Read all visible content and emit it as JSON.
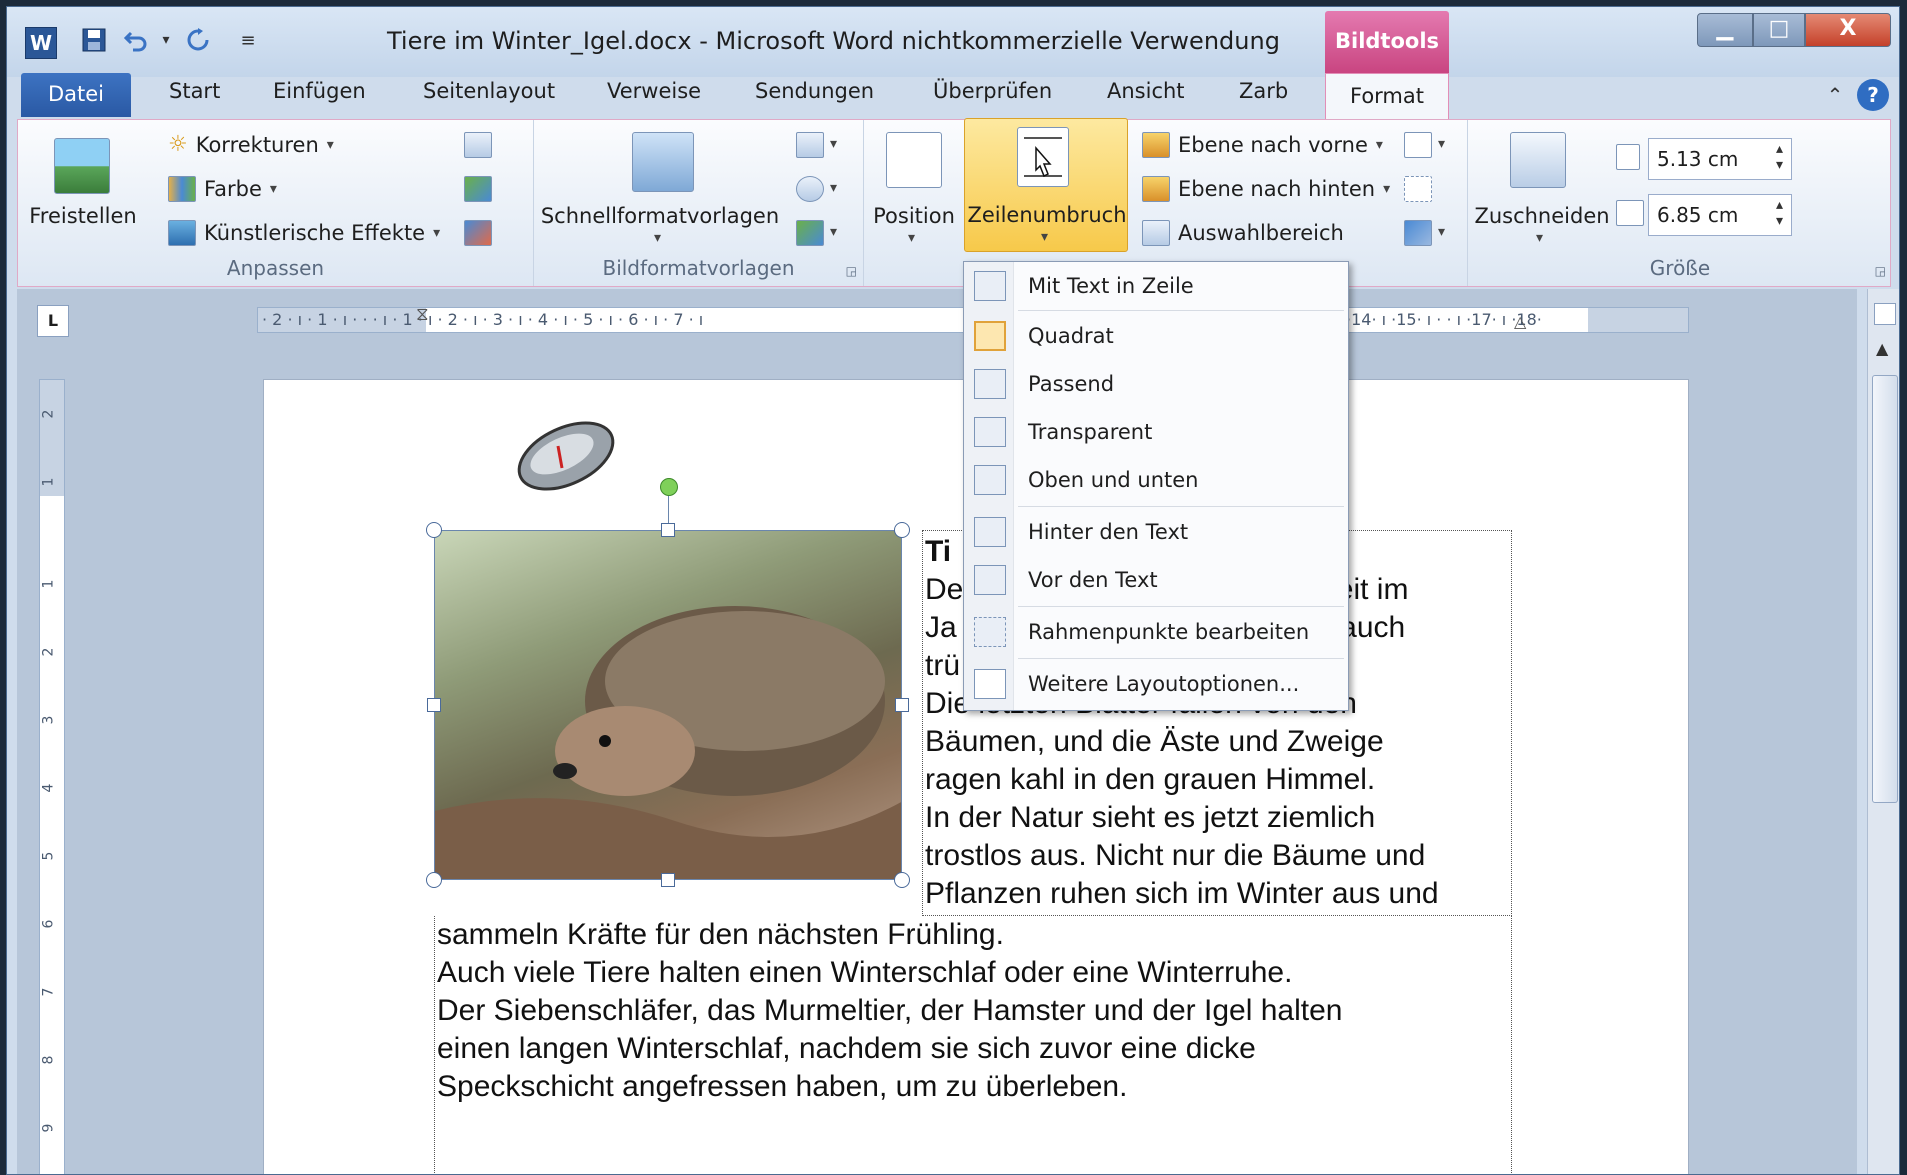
{
  "window": {
    "title": "Tiere im Winter_Igel.docx  -  Microsoft Word nichtkommerzielle Verwendung",
    "context_tab_group": "Bildtools"
  },
  "quick_access": {
    "app_icon": "W",
    "save_icon": "save-icon",
    "undo_icon": "undo-icon",
    "redo_icon": "redo-icon",
    "customize_icon": "customize-icon"
  },
  "window_controls": {
    "minimize": "▁",
    "maximize": "□",
    "close": "X"
  },
  "tabs": [
    {
      "label": "Datei"
    },
    {
      "label": "Start"
    },
    {
      "label": "Einfügen"
    },
    {
      "label": "Seitenlayout"
    },
    {
      "label": "Verweise"
    },
    {
      "label": "Sendungen"
    },
    {
      "label": "Überprüfen"
    },
    {
      "label": "Ansicht"
    },
    {
      "label": "Zarb"
    },
    {
      "label": "Format"
    }
  ],
  "help": {
    "collapse": "⌃",
    "help": "?"
  },
  "ribbon": {
    "anpassen": {
      "label": "Anpassen",
      "freistellen": "Freistellen",
      "korrekturen": "Korrekturen",
      "farbe": "Farbe",
      "effekte": "Künstlerische Effekte"
    },
    "bildformat": {
      "label": "Bildformatvorlagen",
      "schnell": "Schnellformatvorlagen"
    },
    "anordnen": {
      "position": "Position",
      "zeilenumbruch": "Zeilenumbruch",
      "ebene_vorne": "Ebene nach vorne",
      "ebene_hinten": "Ebene nach hinten",
      "auswahl": "Auswahlbereich"
    },
    "groesse": {
      "label": "Größe",
      "zuschneiden": "Zuschneiden",
      "hoehe": "5.13  cm",
      "breite": "6.85  cm"
    }
  },
  "wrap_menu": {
    "items": [
      {
        "label": "Mit Text in Zeile"
      },
      {
        "label": "Quadrat"
      },
      {
        "label": "Passend"
      },
      {
        "label": "Transparent"
      },
      {
        "label": "Oben und unten"
      },
      {
        "label": "Hinter den Text"
      },
      {
        "label": "Vor den Text"
      },
      {
        "label": "Rahmenpunkte bearbeiten"
      },
      {
        "label": "Weitere Layoutoptionen..."
      }
    ],
    "selected": "Quadrat"
  },
  "ruler": {
    "corner": "L",
    "h_text": "· 2 · ı · 1 · ı ·  ·  · ı · 1 · ı · 2 · ı · 3 · ı · 4 · ı · 5 · ı · 6 · ı · 7 · ı",
    "h_text_right": "·14· ı ·15· ı ·  · ı ·17· ı ·18·",
    "v_numbers": [
      "2",
      "1",
      "1",
      "2",
      "3",
      "4",
      "5",
      "6",
      "7",
      "8",
      "9"
    ]
  },
  "document": {
    "right_lines": [
      "Ti",
      "De                                    hreszeit im",
      "Ja                                    nd oft auch",
      "trü",
      "Die letzten Blätter fallen von den",
      "Bäumen, und die Äste und Zweige",
      "ragen kahl in den grauen Himmel.",
      "In der Natur sieht es jetzt ziemlich",
      "trostlos aus. Nicht nur die Bäume und",
      "Pflanzen ruhen sich im Winter aus und"
    ],
    "bottom_lines": [
      "sammeln Kräfte für den nächsten Frühling.",
      "Auch viele Tiere halten einen Winterschlaf oder eine Winterruhe.",
      "Der Siebenschläfer, das Murmeltier, der Hamster und der Igel halten",
      "einen langen Winterschlaf, nachdem sie sich zuvor eine dicke",
      "Speckschicht angefressen haben,  um zu überleben."
    ]
  },
  "colors": {
    "accent_bildtools": "#c8437f",
    "selected_button": "#f9d66b",
    "datei_tab": "#2a59a4"
  }
}
